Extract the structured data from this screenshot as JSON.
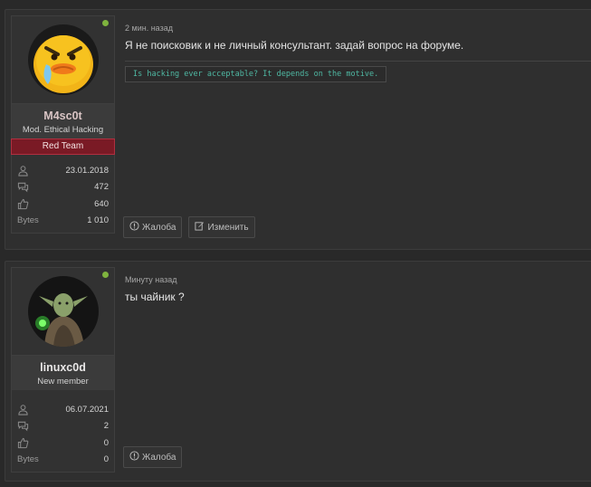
{
  "posts": [
    {
      "username": "M4sc0t",
      "user_title": "Mod. Ethical Hacking",
      "banner": "Red Team",
      "stats": {
        "joined": "23.01.2018",
        "messages": "472",
        "reactions": "640",
        "bytes_label": "Bytes",
        "bytes": "1 010"
      },
      "time": "2 мин. назад",
      "message": "Я не поисковик и не личный консультант. задай вопрос на форуме.",
      "signature": "Is hacking ever acceptable? It depends on the motive.",
      "actions": {
        "report": "Жалоба",
        "edit": "Изменить"
      },
      "online": true,
      "avatar_icon": "angry-duck-avatar"
    },
    {
      "username": "linuxc0d",
      "user_title": "New member",
      "stats": {
        "joined": "06.07.2021",
        "messages": "2",
        "reactions": "0",
        "bytes_label": "Bytes",
        "bytes": "0"
      },
      "time": "Минуту назад",
      "message": "ты чайник ?",
      "actions": {
        "report": "Жалоба"
      },
      "online": true,
      "avatar_icon": "yoda-avatar"
    }
  ],
  "colors": {
    "background": "#292929",
    "online": "#7fb33e",
    "banner": "#7a1a25",
    "signature_text": "#4fb8a3"
  }
}
